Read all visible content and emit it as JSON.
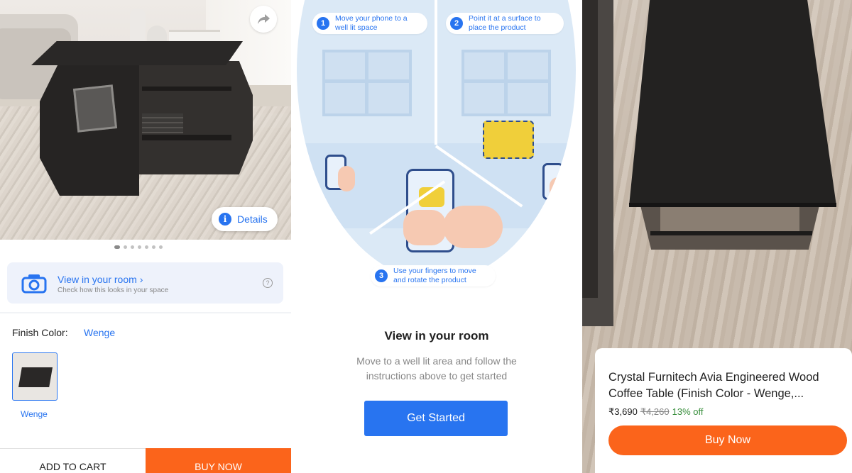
{
  "screen1": {
    "details_label": "Details",
    "carousel_dots": 7,
    "view_room_title": "View in your room",
    "view_room_chevron": "›",
    "view_room_subtitle": "Check how this looks in your space",
    "finish_label": "Finish Color:",
    "finish_value": "Wenge",
    "swatch_label": "Wenge",
    "add_to_cart": "ADD TO CART",
    "buy_now": "BUY NOW",
    "icons": [
      "share-icon",
      "info-icon",
      "camera-icon",
      "help-icon"
    ]
  },
  "screen2": {
    "steps": [
      {
        "num": "1",
        "text": "Move your phone to a well lit space"
      },
      {
        "num": "2",
        "text": "Point it at a surface to place the product"
      },
      {
        "num": "3",
        "text": "Use your fingers to move and rotate the product"
      }
    ],
    "heading": "View in your room",
    "body": "Move to a well lit area and follow the instructions above to get started",
    "button": "Get Started"
  },
  "screen3": {
    "product_title": "Crystal Furnitech Avia Engineered Wood Coffee Table (Finish Color - Wenge,...",
    "price": "₹3,690",
    "mrp": "₹4,260",
    "discount": "13% off",
    "buy_now": "Buy Now"
  },
  "colors": {
    "brand_blue": "#2874f0",
    "buy_orange": "#fb641b",
    "discount_green": "#388e3c"
  }
}
